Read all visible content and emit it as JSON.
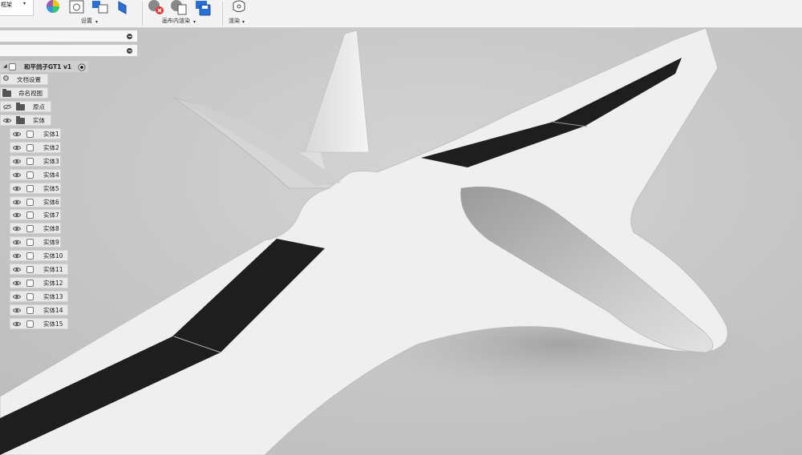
{
  "toolbar": {
    "menu_partial": "框架",
    "groups": [
      {
        "label": "设置"
      },
      {
        "label": "画布内渲染"
      },
      {
        "label": "渲染"
      }
    ]
  },
  "browser": {
    "bar1": "",
    "bar2": "",
    "root": "和平鸽子GT1 v1",
    "doc_settings": "文档设置",
    "named_views": "命名视图",
    "origin": "原点",
    "bodies_folder": "实体",
    "bodies": [
      "实体1",
      "实体2",
      "实体3",
      "实体4",
      "实体5",
      "实体6",
      "实体7",
      "实体8",
      "实体9",
      "实体10",
      "实体11",
      "实体12",
      "实体13",
      "实体14",
      "实体15"
    ]
  },
  "colors": {
    "viewport_bg": "#c9c9c9",
    "model": "#f1f1f1",
    "control_surface": "#1e1e1e",
    "canopy": "#bdbdbd"
  },
  "icons": [
    "appearance-icon",
    "scene-settings-icon",
    "textures-icon",
    "ground-plane-icon",
    "render-stop-icon",
    "capture-image-icon",
    "save-render-icon",
    "render-icon",
    "gear-icon",
    "folder-icon",
    "eye-icon",
    "body-icon"
  ]
}
